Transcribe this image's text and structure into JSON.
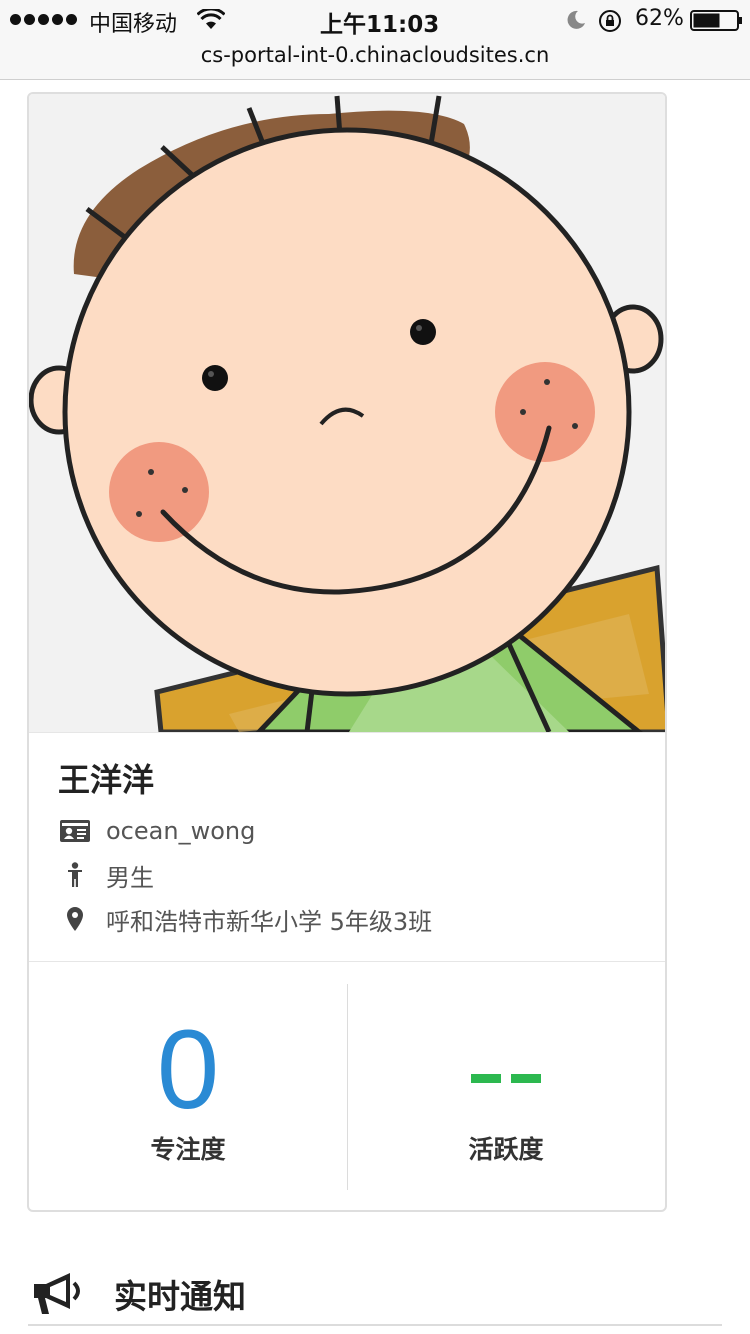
{
  "status_bar": {
    "carrier": "中国移动",
    "time": "上午11:03",
    "battery": "62%",
    "battery_level": 0.62
  },
  "browser": {
    "url": "cs-portal-int-0.chinacloudsites.cn"
  },
  "profile": {
    "name": "王洋洋",
    "username": "ocean_wong",
    "gender": "男生",
    "school": "呼和浩特市新华小学 5年级3班"
  },
  "stats": {
    "focus": {
      "value": "0",
      "label": "专注度",
      "color": "#2a8ad4"
    },
    "activity": {
      "value": "--",
      "label": "活跃度",
      "color": "#2cb84f"
    }
  },
  "notifications": {
    "title": "实时通知"
  },
  "icons": {
    "signal": "signal-dots-icon",
    "wifi": "wifi-icon",
    "moon": "moon-icon",
    "rotation_lock": "rotation-lock-icon",
    "battery": "battery-icon",
    "id_card": "id-card-icon",
    "person": "person-icon",
    "location": "location-pin-icon",
    "megaphone": "megaphone-icon"
  }
}
